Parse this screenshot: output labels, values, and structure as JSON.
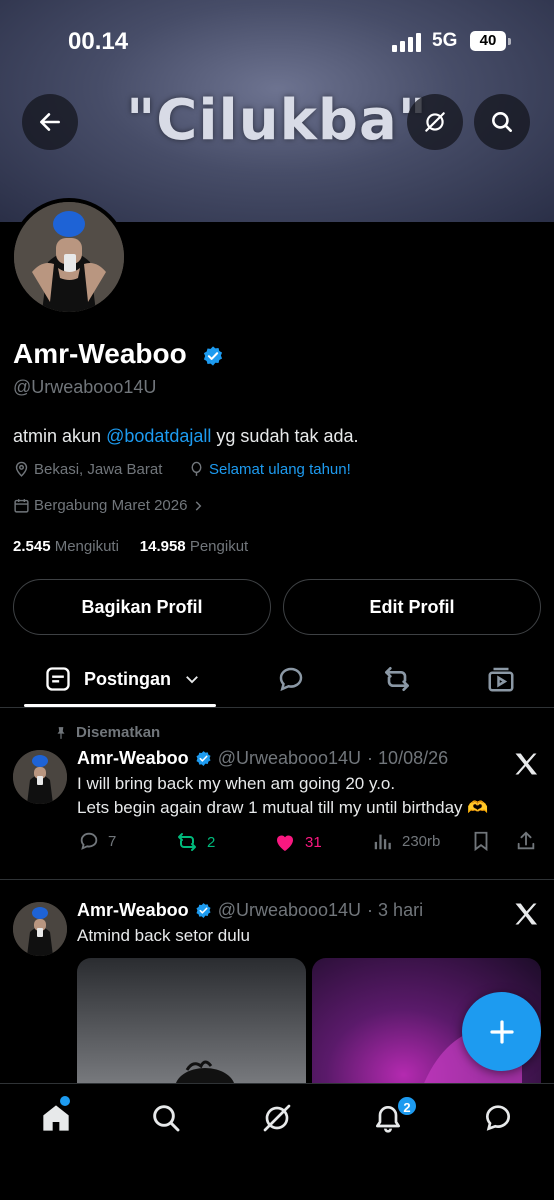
{
  "status_bar": {
    "time": "00.14",
    "network": "5G",
    "battery": "40"
  },
  "banner": {
    "text": "\"Cilukba\""
  },
  "profile": {
    "display_name": "Amr-Weaboo",
    "handle": "@Urweabooo14U",
    "bio_prefix": "atmin akun ",
    "bio_mention": "@bodatdajall",
    "bio_suffix": " yg sudah tak ada.",
    "location": "Bekasi, Jawa Barat",
    "birthday": "Selamat ulang tahun!",
    "joined": "Bergabung Maret 2026",
    "following_count": "2.545",
    "following_label": "Mengikuti",
    "followers_count": "14.958",
    "followers_label": "Pengikut"
  },
  "buttons": {
    "share": "Bagikan Profil",
    "edit": "Edit Profil"
  },
  "tabs": {
    "posts": "Postingan"
  },
  "posts": [
    {
      "pinned_label": "Disematkan",
      "name": "Amr-Weaboo",
      "handle": "@Urweabooo14U",
      "time": "· 10/08/26",
      "line1": "I will bring back my when am going 20 y.o.",
      "line2": "Lets begin again draw 1 mutual till my until birthday 🫶",
      "replies": "7",
      "reposts": "2",
      "likes": "31",
      "views": "230rb"
    },
    {
      "name": "Amr-Weaboo",
      "handle": "@Urweabooo14U",
      "time": "· 3 hari",
      "line1": "Atmind back setor dulu"
    }
  ],
  "nav": {
    "notifications_badge": "2"
  },
  "colors": {
    "accent": "#1d9bf0",
    "like": "#f91880",
    "repost": "#00ba7c",
    "muted": "#71767b"
  }
}
